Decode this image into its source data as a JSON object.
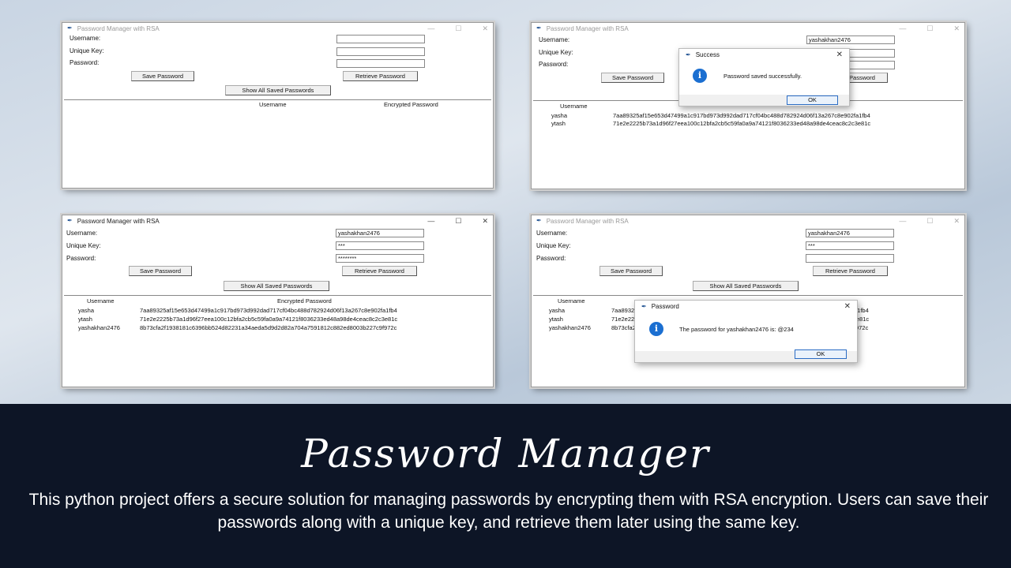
{
  "app": {
    "title": "Password Manager with RSA",
    "labels": {
      "username": "Username:",
      "unique_key": "Unique Key:",
      "password": "Password:"
    },
    "buttons": {
      "save": "Save Password",
      "retrieve": "Retrieve Password",
      "show_all": "Show All Saved Passwords"
    },
    "columns": {
      "username": "Username",
      "encrypted": "Encrypted Password"
    },
    "controls": {
      "minimize": "—",
      "maximize": "☐",
      "close": "✕"
    }
  },
  "screens": [
    {
      "id": "empty",
      "username_value": "",
      "unique_key_value": "",
      "password_value": "",
      "rows": []
    },
    {
      "id": "saved",
      "username_value": "yashakhan2476",
      "unique_key_value": "",
      "password_value": "",
      "rows": [
        {
          "username": "yasha",
          "encrypted": "7aa89325af15e653d47499a1c917bd973d992dad717cf04bc488d782924d06f13a267c8e902fa1fb4"
        },
        {
          "username": "ytash",
          "encrypted": "71e2e2225b73a1d96f27eea100c12bfa2cb5c59fa0a9a74121f8036233ed48a98de4ceac8c2c3e81c"
        }
      ],
      "dialog": {
        "title": "Success",
        "message": "Password saved successfully.",
        "ok": "OK"
      }
    },
    {
      "id": "list",
      "username_value": "yashakhan2476",
      "unique_key_value": "***",
      "password_value": "********",
      "rows": [
        {
          "username": "yasha",
          "encrypted": "7aa89325af15e653d47499a1c917bd973d992dad717cf04bc488d782924d06f13a267c8e902fa1fb4"
        },
        {
          "username": "ytash",
          "encrypted": "71e2e2225b73a1d96f27eea100c12bfa2cb5c59fa0a9a74121f8036233ed48a98de4ceac8c2c3e81c"
        },
        {
          "username": "yashakhan2476",
          "encrypted": "8b73cfa2f1938181c6396bb524d82231a34aeda5d9d2d82a704a7591812c882ed8003b227c9f972c"
        }
      ]
    },
    {
      "id": "retrieve",
      "username_value": "yashakhan2476",
      "unique_key_value": "***",
      "password_value": "",
      "rows": [
        {
          "username": "yasha",
          "encrypted": "7aa89325af15e653d47499a1c917bd973d992dad717cf04bc488d782924d06f13a267c8e902fa1fb4"
        },
        {
          "username": "ytash",
          "encrypted": "71e2e2225b73a1d96f27eea100c12bfa2cb5c59fa0a9a74121f8036233ed48a98de4ceac8c2c3e81c"
        },
        {
          "username": "yashakhan2476",
          "encrypted": "8b73cfa2f1938181c6396bb524d82231a34aeda5d9d2d82a704a7591812c882ed8003b227c9f972c"
        }
      ],
      "dialog": {
        "title": "Password",
        "message": "The password for yashakhan2476 is: @234",
        "ok": "OK"
      }
    }
  ],
  "slide": {
    "heading": "Password Manager",
    "description": "This  python  project offers a secure solution for managing passwords by encrypting them with RSA encryption. Users can save  their passwords along with a unique key, and retrieve  them later using the same key."
  },
  "colors": {
    "panel_bg": "#0d1526",
    "info_icon": "#1b6fd1",
    "ok_border": "#2b6cc4"
  }
}
